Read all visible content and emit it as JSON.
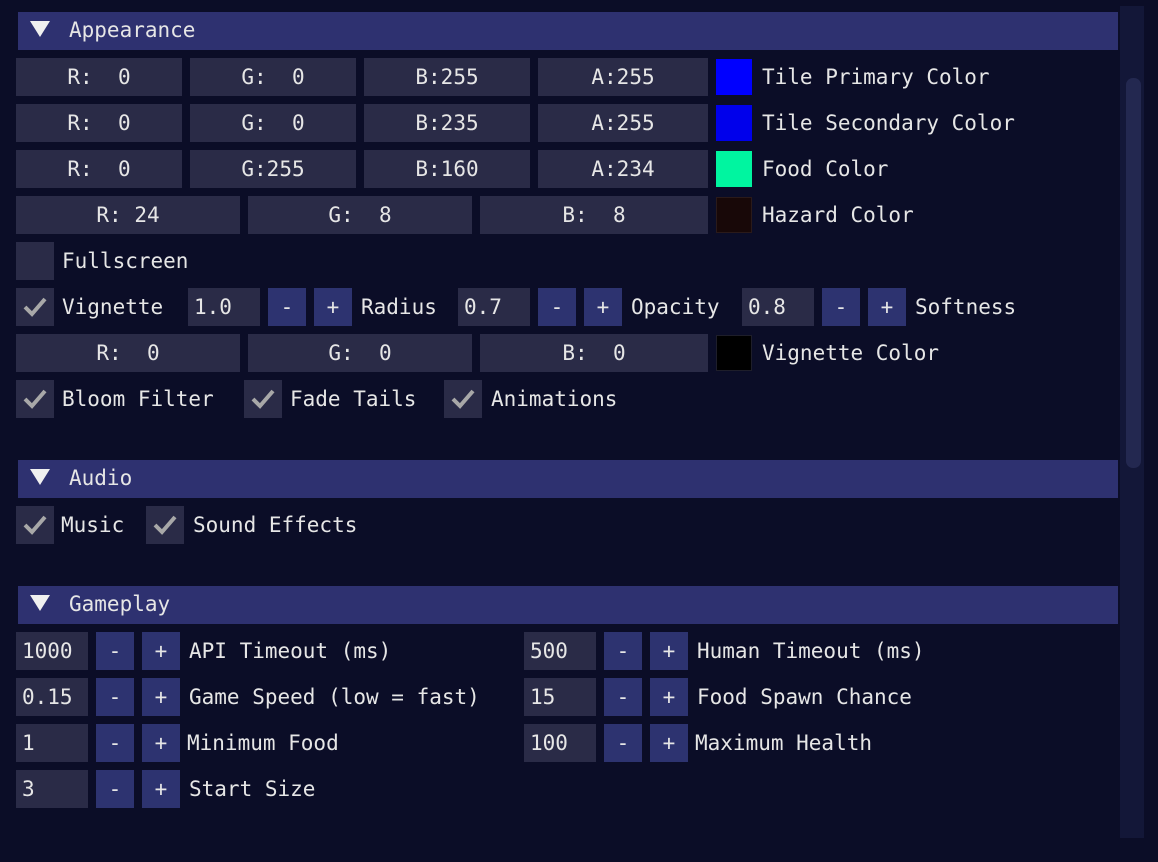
{
  "appearance": {
    "header": "Appearance",
    "tile_primary": {
      "r": "R:  0",
      "g": "G:  0",
      "b": "B:255",
      "a": "A:255",
      "label": "Tile Primary Color",
      "color": "#0000ff"
    },
    "tile_secondary": {
      "r": "R:  0",
      "g": "G:  0",
      "b": "B:235",
      "a": "A:255",
      "label": "Tile Secondary Color",
      "color": "#0000eb"
    },
    "food": {
      "r": "R:  0",
      "g": "G:255",
      "b": "B:160",
      "a": "A:234",
      "label": "Food Color",
      "color": "#00ffa0"
    },
    "hazard": {
      "r": "R: 24",
      "g": "G:  8",
      "b": "B:  8",
      "label": "Hazard Color",
      "color": "#180808"
    },
    "fullscreen": {
      "label": "Fullscreen",
      "checked": false
    },
    "vignette": {
      "label": "Vignette",
      "checked": true,
      "value": "1.0",
      "minus": "-",
      "plus": "+"
    },
    "radius": {
      "label": "Radius",
      "value": "0.7",
      "minus": "-",
      "plus": "+"
    },
    "opacity": {
      "label": "Opacity",
      "value": "0.8",
      "minus": "-",
      "plus": "+"
    },
    "softness": {
      "label": "Softness"
    },
    "vignette_color": {
      "r": "R:  0",
      "g": "G:  0",
      "b": "B:  0",
      "label": "Vignette Color",
      "color": "#000000"
    },
    "bloom": {
      "label": "Bloom Filter",
      "checked": true
    },
    "fade_tails": {
      "label": "Fade Tails",
      "checked": true
    },
    "animations": {
      "label": "Animations",
      "checked": true
    }
  },
  "audio": {
    "header": "Audio",
    "music": {
      "label": "Music",
      "checked": true
    },
    "sound_effects": {
      "label": "Sound Effects",
      "checked": true
    }
  },
  "gameplay": {
    "header": "Gameplay",
    "api_timeout": {
      "value": "1000",
      "label": "API Timeout (ms)",
      "minus": "-",
      "plus": "+"
    },
    "human_timeout": {
      "value": "500",
      "label": "Human Timeout (ms)",
      "minus": "-",
      "plus": "+"
    },
    "game_speed": {
      "value": "0.15",
      "label": "Game Speed (low = fast)",
      "minus": "-",
      "plus": "+"
    },
    "food_spawn": {
      "value": "15",
      "label": "Food Spawn Chance",
      "minus": "-",
      "plus": "+"
    },
    "min_food": {
      "value": "1",
      "label": "Minimum Food",
      "minus": "-",
      "plus": "+"
    },
    "max_health": {
      "value": "100",
      "label": "Maximum Health",
      "minus": "-",
      "plus": "+"
    },
    "start_size": {
      "value": "3",
      "label": "Start Size",
      "minus": "-",
      "plus": "+"
    }
  },
  "colors": {
    "header_bg": "#2e3170",
    "field_bg": "#2a2b47",
    "button_bg": "#2d3370",
    "window_bg": "#0b0d27"
  }
}
